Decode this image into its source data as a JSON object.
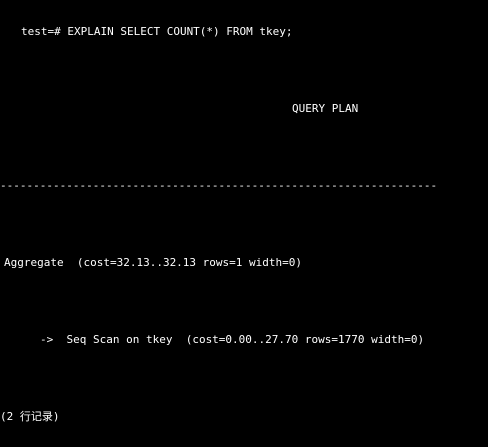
{
  "terminal": {
    "background_color": "#000000",
    "text_color": "#ffffff",
    "prompt_line": "test=# EXPLAIN SELECT COUNT(*) FROM tkey;",
    "column_header": "QUERY PLAN",
    "separator": "------------------------------------------------------------------",
    "plan_rows": [
      "Aggregate  (cost=32.13..32.13 rows=1 width=0)",
      "->  Seq Scan on tkey  (cost=0.00..27.70 rows=1770 width=0)"
    ],
    "row_count": "(2 行记录)"
  }
}
